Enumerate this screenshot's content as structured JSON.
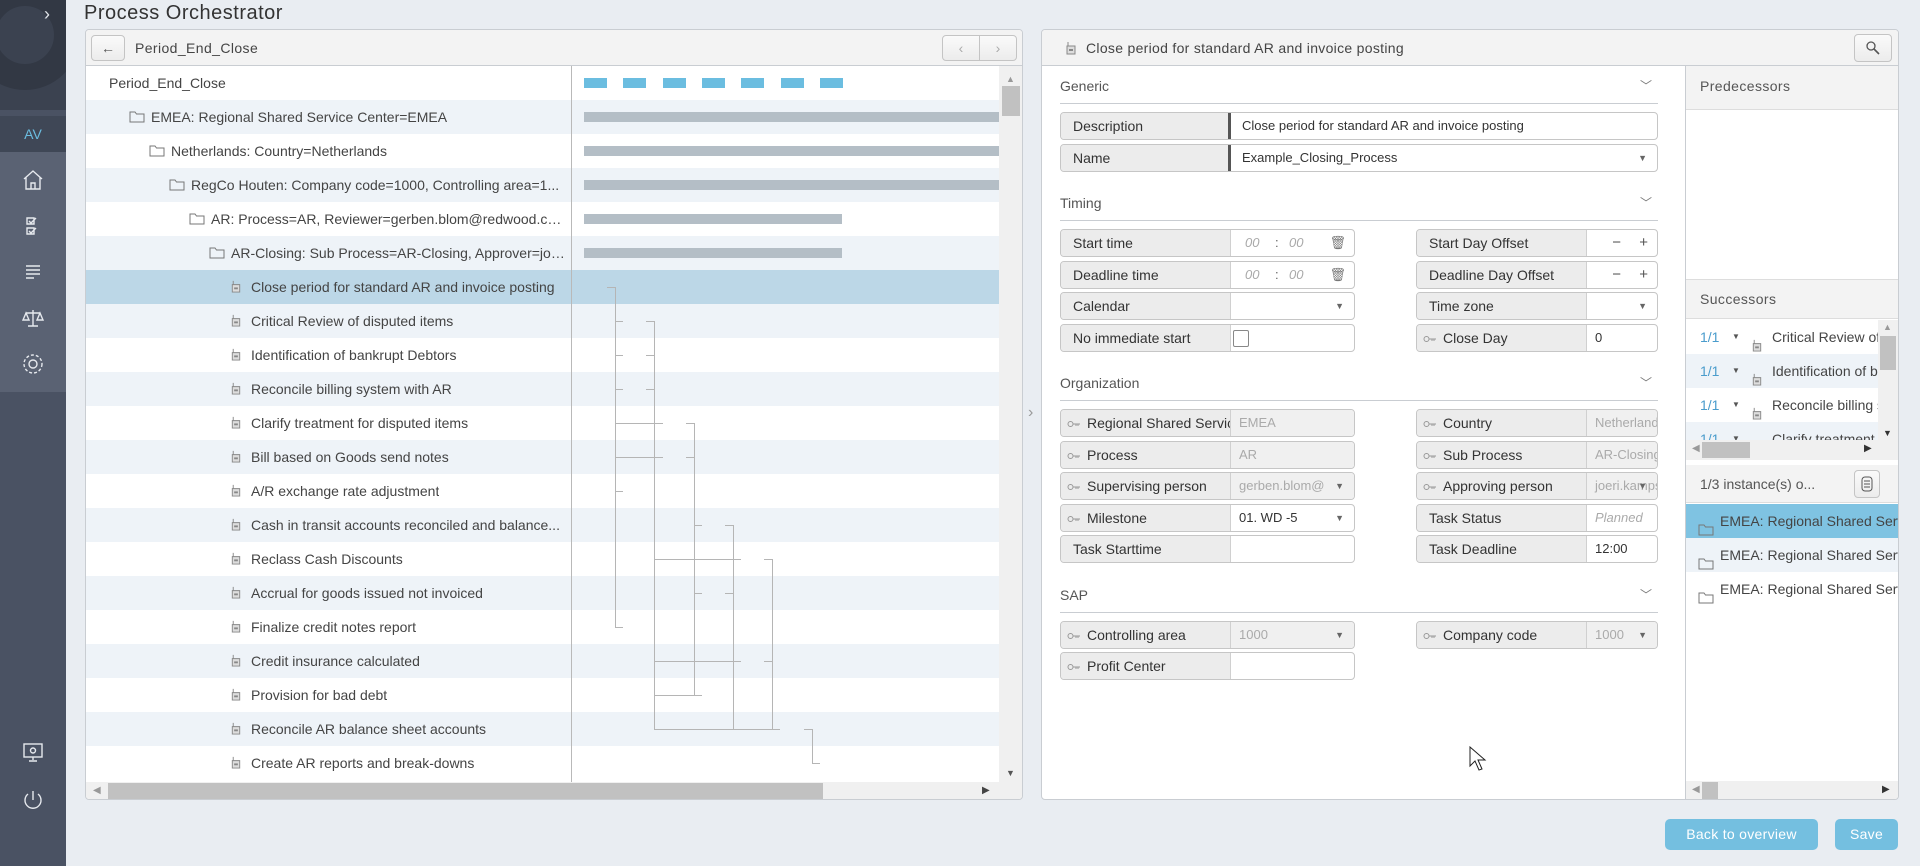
{
  "app": {
    "title": "Process Orchestrator",
    "user_initials": "AV"
  },
  "colors": {
    "accent": "#6bbde0",
    "selected_row": "#bcd7e7",
    "summary_bar": "#b4bec6",
    "button": "#74bfe0",
    "sidebar": "#4a5263"
  },
  "sidebar": {
    "icons": [
      "expand-chevron-icon",
      "home-icon",
      "checklist-icon",
      "list-icon",
      "scales-icon",
      "gear-icon",
      "monitor-settings-icon",
      "power-icon"
    ]
  },
  "tree": {
    "breadcrumb": "Period_End_Close",
    "back_label": "←",
    "prev_label": "‹",
    "next_label": "›",
    "rows": [
      {
        "label": "Period_End_Close",
        "level": 0,
        "type": "root"
      },
      {
        "label": "EMEA: Regional Shared Service Center=EMEA",
        "level": 1,
        "type": "folder",
        "bar": [
          0,
          11
        ]
      },
      {
        "label": "Netherlands: Country=Netherlands",
        "level": 2,
        "type": "folder",
        "bar": [
          0,
          11
        ]
      },
      {
        "label": "RegCo Houten: Company code=1000, Controlling area=1...",
        "level": 3,
        "type": "folder",
        "bar": [
          0,
          11
        ]
      },
      {
        "label": "AR: Process=AR, Reviewer=gerben.blom@redwood.co...",
        "level": 4,
        "type": "folder",
        "bar": [
          0,
          7
        ]
      },
      {
        "label": "AR-Closing: Sub Process=AR-Closing, Approver=joe...",
        "level": 5,
        "type": "folder",
        "bar": [
          0,
          7
        ]
      },
      {
        "label": "Close period for standard AR and invoice posting",
        "level": 6,
        "type": "task",
        "slot": 0,
        "selected": true
      },
      {
        "label": "Critical Review of disputed items",
        "level": 6,
        "type": "task",
        "slot": 1,
        "after": [
          6
        ]
      },
      {
        "label": "Identification of bankrupt Debtors",
        "level": 6,
        "type": "task",
        "slot": 1,
        "after": [
          6
        ]
      },
      {
        "label": "Reconcile billing system with AR",
        "level": 6,
        "type": "task",
        "slot": 1,
        "after": [
          6
        ]
      },
      {
        "label": "Clarify treatment for disputed items",
        "level": 6,
        "type": "task",
        "slot": 2,
        "after": [
          6,
          7
        ]
      },
      {
        "label": "Bill based on Goods send notes",
        "level": 6,
        "type": "task",
        "slot": 2,
        "after": [
          6,
          8
        ]
      },
      {
        "label": "A/R exchange rate adjustment",
        "level": 6,
        "type": "task",
        "slot": 1,
        "after": [
          6
        ]
      },
      {
        "label": "Cash in transit accounts reconciled and balance...",
        "level": 6,
        "type": "task",
        "slot": 3,
        "after": [
          10
        ]
      },
      {
        "label": "Reclass Cash Discounts",
        "level": 6,
        "type": "task",
        "slot": 4,
        "after": [
          13,
          9
        ]
      },
      {
        "label": "Accrual for goods issued not invoiced",
        "level": 6,
        "type": "task",
        "slot": 3,
        "after": [
          11
        ]
      },
      {
        "label": "Finalize credit notes report",
        "level": 6,
        "type": "task",
        "slot": 1,
        "after": [
          6
        ]
      },
      {
        "label": "Credit insurance calculated",
        "level": 6,
        "type": "task",
        "slot": 4,
        "after": [
          13,
          9
        ]
      },
      {
        "label": "Provision for bad debt",
        "level": 6,
        "type": "task",
        "slot": 3,
        "after": [
          11,
          8
        ]
      },
      {
        "label": "Reconcile AR balance sheet accounts",
        "level": 6,
        "type": "task",
        "slot": 5,
        "after": [
          14,
          15,
          17,
          8
        ]
      },
      {
        "label": "Create AR reports and break-downs",
        "level": 6,
        "type": "task",
        "slot": 6,
        "after": [
          19
        ]
      }
    ]
  },
  "detail": {
    "title": "Close period for standard AR and invoice posting",
    "sections": [
      {
        "title": "Generic",
        "rows": [
          [
            {
              "label": "Description",
              "value": "Close period for standard AR and invoice posting",
              "full": true
            }
          ],
          [
            {
              "label": "Name",
              "value": "Example_Closing_Process",
              "full": true,
              "dropdown": true
            }
          ]
        ]
      },
      {
        "title": "Timing",
        "rows": [
          [
            {
              "label": "Start time",
              "kind": "time",
              "h": "00",
              "m": "00"
            },
            {
              "label": "Start Day Offset",
              "kind": "stepper",
              "minus": "−",
              "plus": "+"
            }
          ],
          [
            {
              "label": "Deadline time",
              "kind": "time",
              "h": "00",
              "m": "00"
            },
            {
              "label": "Deadline Day Offset",
              "kind": "stepper",
              "minus": "−",
              "plus": "+"
            }
          ],
          [
            {
              "label": "Calendar",
              "value": "",
              "dropdown": true
            },
            {
              "label": "Time zone",
              "value": "",
              "dropdown": true
            }
          ],
          [
            {
              "label": "No immediate start",
              "kind": "checkbox",
              "checked": false
            },
            {
              "label": "Close Day",
              "key": true,
              "value": "0"
            }
          ]
        ]
      },
      {
        "title": "Organization",
        "rows": [
          [
            {
              "label": "Regional Shared Service Center",
              "key": true,
              "value": "EMEA",
              "disabled": true
            },
            {
              "label": "Country",
              "key": true,
              "value": "Netherlands",
              "disabled": true
            }
          ],
          [
            {
              "label": "Process",
              "key": true,
              "value": "AR",
              "disabled": true
            },
            {
              "label": "Sub Process",
              "key": true,
              "value": "AR-Closing",
              "disabled": true
            }
          ],
          [
            {
              "label": "Supervising person",
              "key": true,
              "value": "gerben.blom@",
              "disabled": true,
              "dropdown": true
            },
            {
              "label": "Approving person",
              "key": true,
              "value": "joeri.kampsch",
              "disabled": true,
              "dropdown": true
            }
          ],
          [
            {
              "label": "Milestone",
              "key": true,
              "value": "01. WD -5",
              "dropdown": true
            },
            {
              "label": "Task Status",
              "value": "Planned",
              "placeholder": true
            }
          ],
          [
            {
              "label": "Task Starttime",
              "value": ""
            },
            {
              "label": "Task Deadline",
              "value": "12:00"
            }
          ]
        ]
      },
      {
        "title": "SAP",
        "rows": [
          [
            {
              "label": "Controlling area",
              "key": true,
              "value": "1000",
              "disabled": true,
              "dropdown": true
            },
            {
              "label": "Company code",
              "key": true,
              "value": "1000",
              "disabled": true,
              "dropdown": true
            }
          ],
          [
            {
              "label": "Profit Center",
              "key": true,
              "value": ""
            }
          ]
        ]
      }
    ]
  },
  "relations": {
    "predecessors_title": "Predecessors",
    "successors_title": "Successors",
    "successors": [
      {
        "count": "1/1",
        "label": "Critical Review of disputed items"
      },
      {
        "count": "1/1",
        "label": "Identification of bankrupt Debtors"
      },
      {
        "count": "1/1",
        "label": "Reconcile billing system with AR"
      },
      {
        "count": "1/1",
        "label": "Clarify treatment for disputed items"
      }
    ],
    "instances_label": "1/3 instance(s) o...",
    "instances": [
      {
        "label": "EMEA: Regional Shared Service Center=EMEA",
        "selected": true
      },
      {
        "label": "EMEA: Regional Shared Service Center=EMEA"
      },
      {
        "label": "EMEA: Regional Shared Service Center=EMEA"
      }
    ]
  },
  "footer": {
    "back_label": "Back to overview",
    "save_label": "Save"
  }
}
